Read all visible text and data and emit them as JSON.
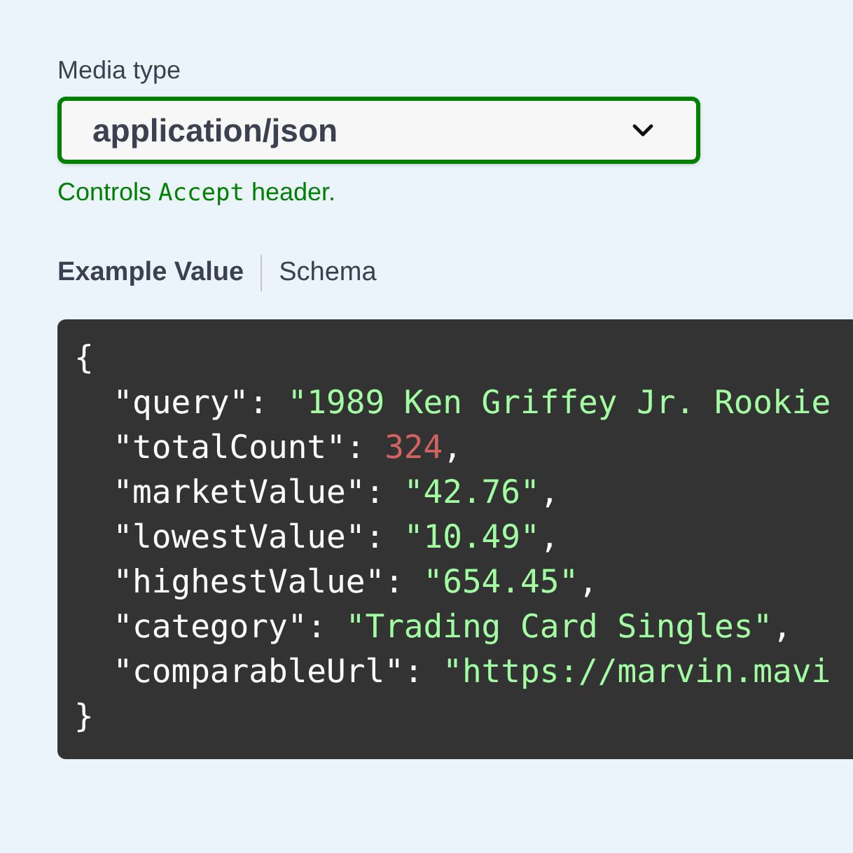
{
  "media_type": {
    "label": "Media type",
    "value": "application/json",
    "helper": [
      {
        "text": "Controls ",
        "kind": "plain"
      },
      {
        "text": "Accept",
        "kind": "code"
      },
      {
        "text": " header.",
        "kind": "plain"
      }
    ]
  },
  "tabs": [
    {
      "label": "Example Value",
      "selected": true
    },
    {
      "label": "Schema",
      "selected": false
    }
  ],
  "example": [
    [
      {
        "text": "{",
        "kind": "punct"
      }
    ],
    [
      {
        "text": "  \"query\": ",
        "kind": "punct"
      },
      {
        "text": "\"1989 Ken Griffey Jr. Rookie",
        "kind": "string"
      }
    ],
    [
      {
        "text": "  \"totalCount\": ",
        "kind": "punct"
      },
      {
        "text": "324",
        "kind": "number"
      },
      {
        "text": ",",
        "kind": "punct"
      }
    ],
    [
      {
        "text": "  \"marketValue\": ",
        "kind": "punct"
      },
      {
        "text": "\"42.76\"",
        "kind": "string"
      },
      {
        "text": ",",
        "kind": "punct"
      }
    ],
    [
      {
        "text": "  \"lowestValue\": ",
        "kind": "punct"
      },
      {
        "text": "\"10.49\"",
        "kind": "string"
      },
      {
        "text": ",",
        "kind": "punct"
      }
    ],
    [
      {
        "text": "  \"highestValue\": ",
        "kind": "punct"
      },
      {
        "text": "\"654.45\"",
        "kind": "string"
      },
      {
        "text": ",",
        "kind": "punct"
      }
    ],
    [
      {
        "text": "  \"category\": ",
        "kind": "punct"
      },
      {
        "text": "\"Trading Card Singles\"",
        "kind": "string"
      },
      {
        "text": ",",
        "kind": "punct"
      }
    ],
    [
      {
        "text": "  \"comparableUrl\": ",
        "kind": "punct"
      },
      {
        "text": "\"https://marvin.mavi",
        "kind": "string"
      }
    ],
    [
      {
        "text": "}",
        "kind": "punct"
      }
    ]
  ]
}
